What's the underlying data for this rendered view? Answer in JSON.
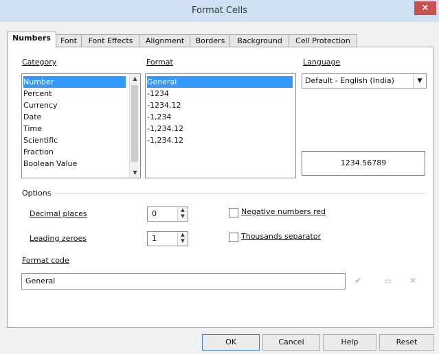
{
  "window": {
    "title": "Format Cells",
    "close_glyph": "×"
  },
  "tabs": [
    {
      "label": "Numbers",
      "active": true
    },
    {
      "label": "Font"
    },
    {
      "label": "Font Effects"
    },
    {
      "label": "Alignment"
    },
    {
      "label": "Borders"
    },
    {
      "label": "Background"
    },
    {
      "label": "Cell Protection"
    }
  ],
  "category": {
    "label": "Category",
    "items": [
      "Number",
      "Percent",
      "Currency",
      "Date",
      "Time",
      "Scientific",
      "Fraction",
      "Boolean Value"
    ],
    "selected": "Number"
  },
  "format": {
    "label": "Format",
    "items": [
      "General",
      "-1234",
      "-1234.12",
      "-1,234",
      "-1,234.12",
      "-1,234.12"
    ],
    "selected": "General"
  },
  "language": {
    "label": "Language",
    "value": "Default - English (India)"
  },
  "preview": {
    "value": "1234.56789"
  },
  "options": {
    "label": "Options",
    "decimal_places": {
      "label": "Decimal places",
      "value": "0"
    },
    "leading_zeroes": {
      "label": "Leading zeroes",
      "value": "1"
    },
    "negative_red": {
      "label": "Negative numbers red",
      "checked": false
    },
    "thousands_sep": {
      "label": "Thousands separator",
      "checked": false
    }
  },
  "format_code": {
    "label": "Format code",
    "value": "General"
  },
  "buttons": {
    "ok": "OK",
    "cancel": "Cancel",
    "help": "Help",
    "reset": "Reset"
  },
  "icons": [
    "checkmark-icon",
    "comment-icon",
    "delete-icon"
  ]
}
